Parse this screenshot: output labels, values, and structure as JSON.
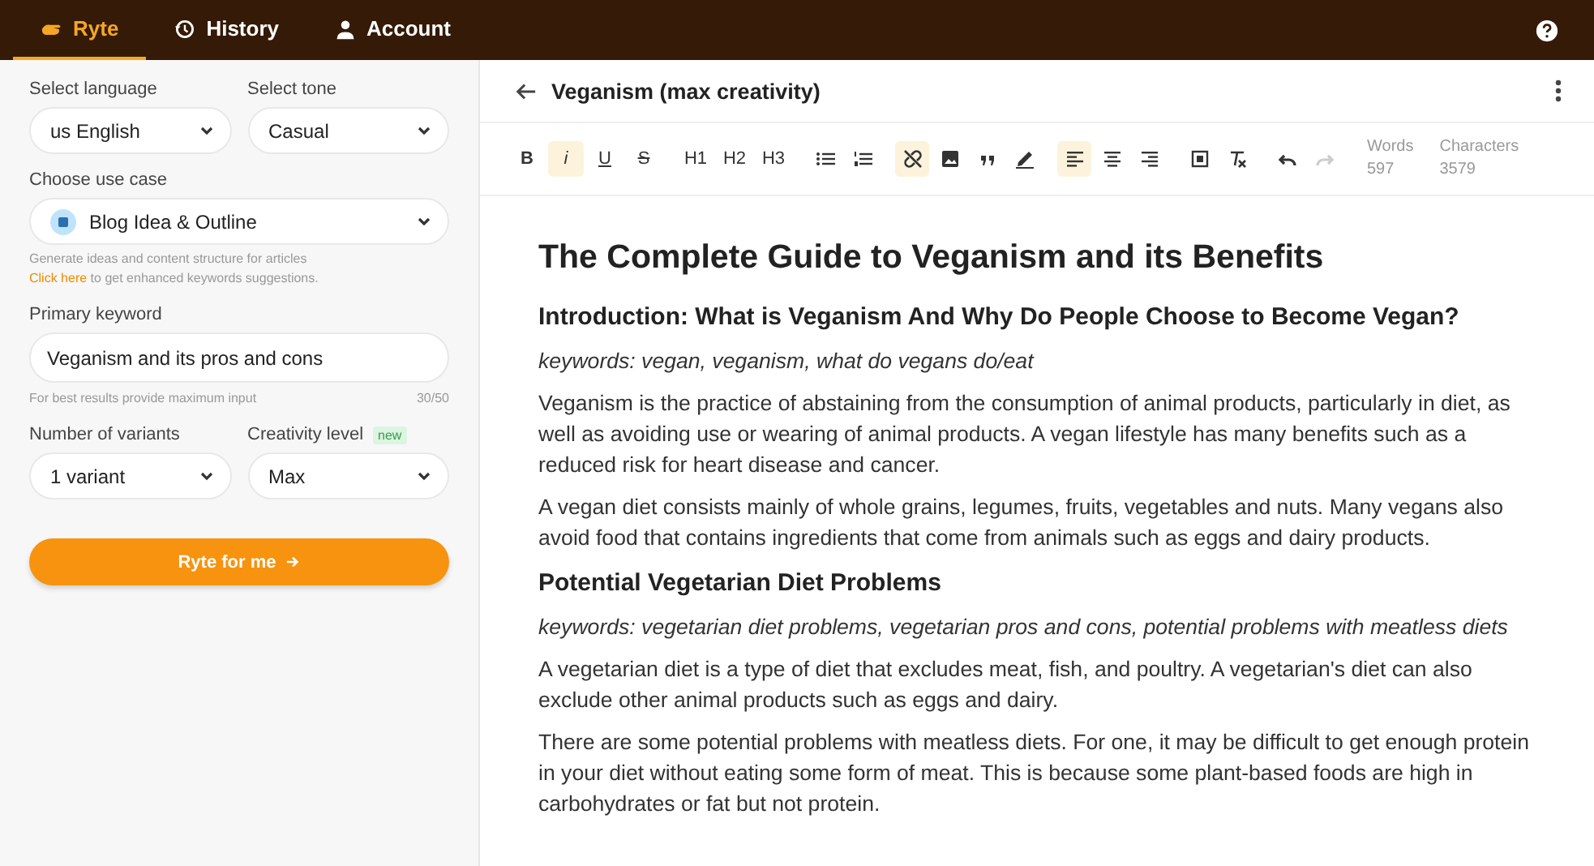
{
  "nav": {
    "tabs": [
      {
        "label": "Ryte",
        "selected": true
      },
      {
        "label": "History",
        "selected": false
      },
      {
        "label": "Account",
        "selected": false
      }
    ]
  },
  "form": {
    "language": {
      "label": "Select language",
      "value": "us English"
    },
    "tone": {
      "label": "Select tone",
      "value": "Casual"
    },
    "use_case": {
      "label": "Choose use case",
      "value": "Blog Idea & Outline",
      "hint": "Generate ideas and content structure for articles",
      "link": "Click here",
      "link_suffix": " to get enhanced keywords suggestions."
    },
    "keyword": {
      "label": "Primary keyword",
      "value": "Veganism and its pros and cons",
      "hint": "For best results provide maximum input",
      "counter": "30/50"
    },
    "variants": {
      "label": "Number of variants",
      "value": "1 variant"
    },
    "creativity": {
      "label": "Creativity level",
      "badge": "new",
      "value": "Max"
    },
    "submit": "Ryte for me"
  },
  "editor": {
    "title": "Veganism (max creativity)",
    "toolbar": [
      [
        {
          "kind": "bold",
          "label": "B",
          "active": false
        },
        {
          "kind": "italic",
          "label": "i",
          "active": true
        },
        {
          "kind": "underline",
          "label": "U",
          "active": false
        },
        {
          "kind": "strike",
          "label": "S",
          "active": false
        }
      ],
      [
        {
          "kind": "text",
          "label": "H1",
          "active": false
        },
        {
          "kind": "text",
          "label": "H2",
          "active": false
        },
        {
          "kind": "text",
          "label": "H3",
          "active": false
        }
      ],
      [
        {
          "kind": "bullets",
          "active": false
        },
        {
          "kind": "numbers",
          "active": false
        }
      ],
      [
        {
          "kind": "unlink",
          "active": true
        },
        {
          "kind": "image",
          "active": false
        },
        {
          "kind": "quote",
          "active": false
        },
        {
          "kind": "pen",
          "active": false
        }
      ],
      [
        {
          "kind": "align-left",
          "active": true
        },
        {
          "kind": "align-center",
          "active": false
        },
        {
          "kind": "align-right",
          "active": false
        }
      ],
      [
        {
          "kind": "frame",
          "active": false
        },
        {
          "kind": "clear",
          "active": false
        }
      ],
      [
        {
          "kind": "undo",
          "active": false,
          "disabled": false
        },
        {
          "kind": "redo",
          "active": false,
          "disabled": true
        }
      ]
    ],
    "stats": [
      {
        "label": "Words",
        "value": "597"
      },
      {
        "label": "Characters",
        "value": "3579"
      }
    ],
    "blocks": [
      {
        "kind": "title",
        "text": "The Complete Guide to Veganism and its Benefits"
      },
      {
        "kind": "heading",
        "text": "Introduction: What is Veganism And Why Do People Choose to Become Vegan?"
      },
      {
        "kind": "keywords",
        "text": "keywords: vegan, veganism, what do vegans do/eat"
      },
      {
        "kind": "paragraph",
        "text": "Veganism is the practice of abstaining from the consumption of animal products, particularly in diet, as well as avoiding use or wearing of animal products. A vegan lifestyle has many benefits such as a reduced risk for heart disease and cancer."
      },
      {
        "kind": "paragraph",
        "text": "A vegan diet consists mainly of whole grains, legumes, fruits, vegetables and nuts. Many vegans also avoid food that contains ingredients that come from animals such as eggs and dairy products."
      },
      {
        "kind": "heading",
        "text": "Potential Vegetarian Diet Problems"
      },
      {
        "kind": "keywords",
        "text": "keywords: vegetarian diet problems, vegetarian pros and cons, potential problems with meatless diets"
      },
      {
        "kind": "paragraph",
        "text": "A vegetarian diet is a type of diet that excludes meat, fish, and poultry. A vegetarian's diet can also exclude other animal products such as eggs and dairy."
      },
      {
        "kind": "paragraph",
        "text": "There are some potential problems with meatless diets. For one, it may be difficult to get enough protein in your diet without eating some form of meat. This is because some plant-based foods are high in carbohydrates or fat but not protein."
      }
    ]
  }
}
